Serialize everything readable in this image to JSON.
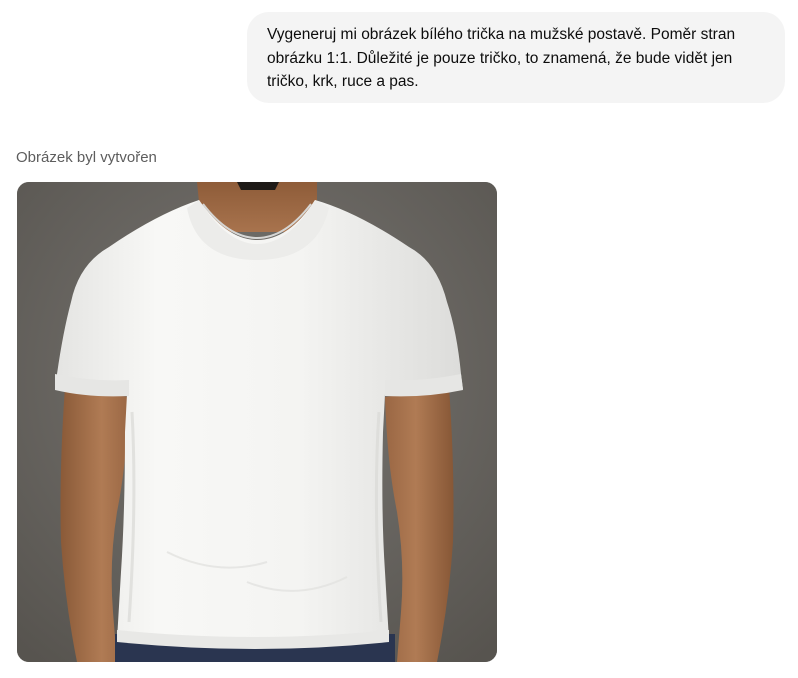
{
  "conversation": {
    "user_message": "Vygeneruj mi obrázek bílého trička na mužské postavě. Poměr stran obrázku 1:1. Důležité je pouze tričko, to znamená, že bude vidět jen tričko, krk, ruce a pas.",
    "assistant_status": "Obrázek byl vytvořen"
  },
  "colors": {
    "bubble_bg": "#f4f4f4",
    "status_text": "#5d5d5d",
    "image_bg": "#6b6865",
    "shirt": "#f3f3f1",
    "skin": "#a5714c",
    "jeans": "#2a3550"
  },
  "icons": {
    "generated_image": "white-tshirt-on-man-photo"
  }
}
